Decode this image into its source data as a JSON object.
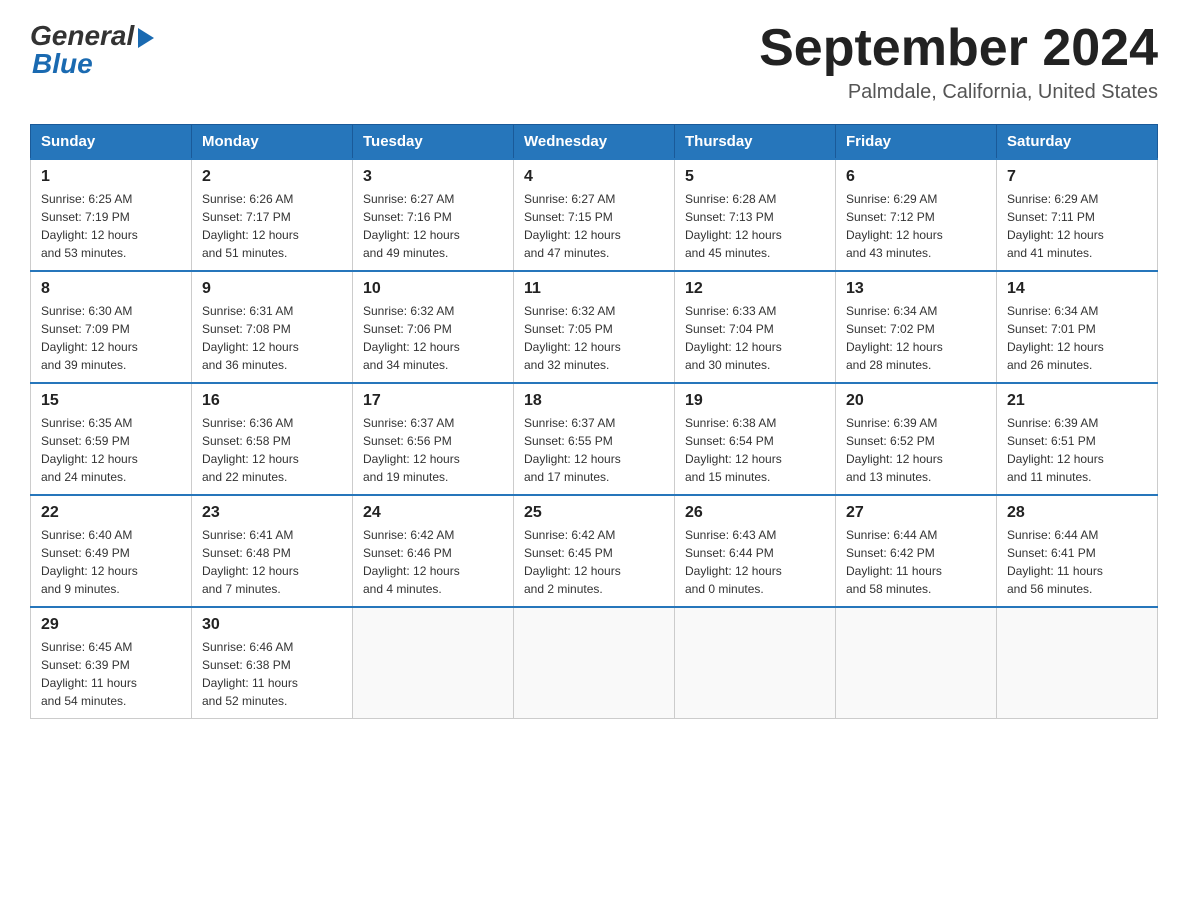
{
  "header": {
    "logo_general": "General",
    "logo_blue": "Blue",
    "title": "September 2024",
    "subtitle": "Palmdale, California, United States"
  },
  "days_of_week": [
    "Sunday",
    "Monday",
    "Tuesday",
    "Wednesday",
    "Thursday",
    "Friday",
    "Saturday"
  ],
  "weeks": [
    [
      {
        "day": "1",
        "sunrise": "6:25 AM",
        "sunset": "7:19 PM",
        "daylight": "12 hours and 53 minutes."
      },
      {
        "day": "2",
        "sunrise": "6:26 AM",
        "sunset": "7:17 PM",
        "daylight": "12 hours and 51 minutes."
      },
      {
        "day": "3",
        "sunrise": "6:27 AM",
        "sunset": "7:16 PM",
        "daylight": "12 hours and 49 minutes."
      },
      {
        "day": "4",
        "sunrise": "6:27 AM",
        "sunset": "7:15 PM",
        "daylight": "12 hours and 47 minutes."
      },
      {
        "day": "5",
        "sunrise": "6:28 AM",
        "sunset": "7:13 PM",
        "daylight": "12 hours and 45 minutes."
      },
      {
        "day": "6",
        "sunrise": "6:29 AM",
        "sunset": "7:12 PM",
        "daylight": "12 hours and 43 minutes."
      },
      {
        "day": "7",
        "sunrise": "6:29 AM",
        "sunset": "7:11 PM",
        "daylight": "12 hours and 41 minutes."
      }
    ],
    [
      {
        "day": "8",
        "sunrise": "6:30 AM",
        "sunset": "7:09 PM",
        "daylight": "12 hours and 39 minutes."
      },
      {
        "day": "9",
        "sunrise": "6:31 AM",
        "sunset": "7:08 PM",
        "daylight": "12 hours and 36 minutes."
      },
      {
        "day": "10",
        "sunrise": "6:32 AM",
        "sunset": "7:06 PM",
        "daylight": "12 hours and 34 minutes."
      },
      {
        "day": "11",
        "sunrise": "6:32 AM",
        "sunset": "7:05 PM",
        "daylight": "12 hours and 32 minutes."
      },
      {
        "day": "12",
        "sunrise": "6:33 AM",
        "sunset": "7:04 PM",
        "daylight": "12 hours and 30 minutes."
      },
      {
        "day": "13",
        "sunrise": "6:34 AM",
        "sunset": "7:02 PM",
        "daylight": "12 hours and 28 minutes."
      },
      {
        "day": "14",
        "sunrise": "6:34 AM",
        "sunset": "7:01 PM",
        "daylight": "12 hours and 26 minutes."
      }
    ],
    [
      {
        "day": "15",
        "sunrise": "6:35 AM",
        "sunset": "6:59 PM",
        "daylight": "12 hours and 24 minutes."
      },
      {
        "day": "16",
        "sunrise": "6:36 AM",
        "sunset": "6:58 PM",
        "daylight": "12 hours and 22 minutes."
      },
      {
        "day": "17",
        "sunrise": "6:37 AM",
        "sunset": "6:56 PM",
        "daylight": "12 hours and 19 minutes."
      },
      {
        "day": "18",
        "sunrise": "6:37 AM",
        "sunset": "6:55 PM",
        "daylight": "12 hours and 17 minutes."
      },
      {
        "day": "19",
        "sunrise": "6:38 AM",
        "sunset": "6:54 PM",
        "daylight": "12 hours and 15 minutes."
      },
      {
        "day": "20",
        "sunrise": "6:39 AM",
        "sunset": "6:52 PM",
        "daylight": "12 hours and 13 minutes."
      },
      {
        "day": "21",
        "sunrise": "6:39 AM",
        "sunset": "6:51 PM",
        "daylight": "12 hours and 11 minutes."
      }
    ],
    [
      {
        "day": "22",
        "sunrise": "6:40 AM",
        "sunset": "6:49 PM",
        "daylight": "12 hours and 9 minutes."
      },
      {
        "day": "23",
        "sunrise": "6:41 AM",
        "sunset": "6:48 PM",
        "daylight": "12 hours and 7 minutes."
      },
      {
        "day": "24",
        "sunrise": "6:42 AM",
        "sunset": "6:46 PM",
        "daylight": "12 hours and 4 minutes."
      },
      {
        "day": "25",
        "sunrise": "6:42 AM",
        "sunset": "6:45 PM",
        "daylight": "12 hours and 2 minutes."
      },
      {
        "day": "26",
        "sunrise": "6:43 AM",
        "sunset": "6:44 PM",
        "daylight": "12 hours and 0 minutes."
      },
      {
        "day": "27",
        "sunrise": "6:44 AM",
        "sunset": "6:42 PM",
        "daylight": "11 hours and 58 minutes."
      },
      {
        "day": "28",
        "sunrise": "6:44 AM",
        "sunset": "6:41 PM",
        "daylight": "11 hours and 56 minutes."
      }
    ],
    [
      {
        "day": "29",
        "sunrise": "6:45 AM",
        "sunset": "6:39 PM",
        "daylight": "11 hours and 54 minutes."
      },
      {
        "day": "30",
        "sunrise": "6:46 AM",
        "sunset": "6:38 PM",
        "daylight": "11 hours and 52 minutes."
      },
      null,
      null,
      null,
      null,
      null
    ]
  ],
  "labels": {
    "sunrise": "Sunrise:",
    "sunset": "Sunset:",
    "daylight": "Daylight:"
  }
}
